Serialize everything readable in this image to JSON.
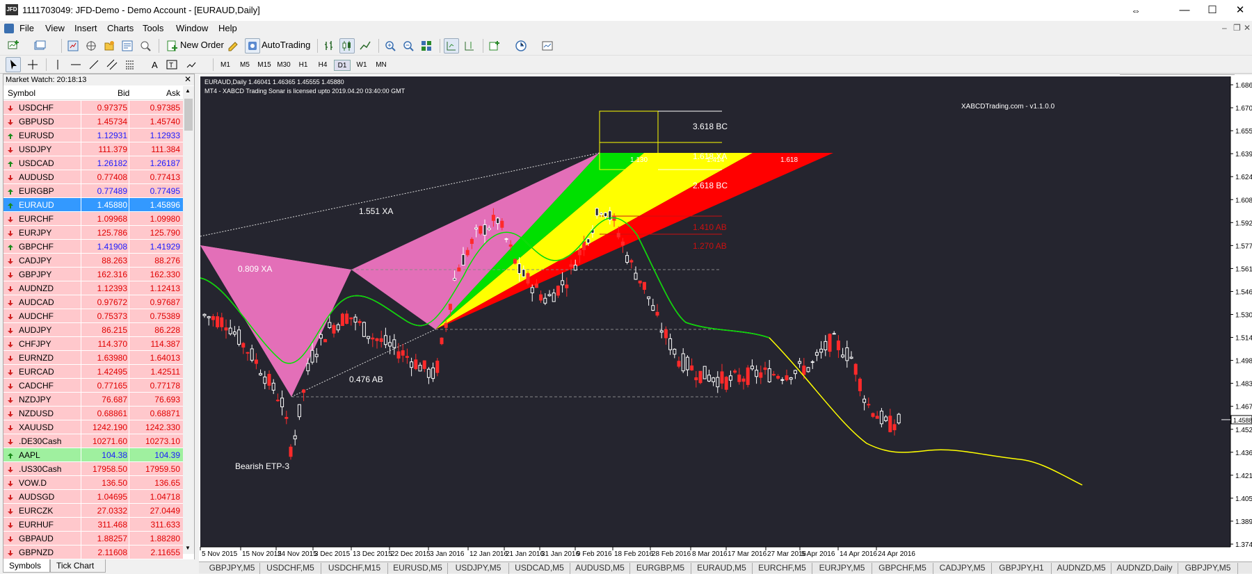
{
  "window": {
    "title": "1111703049: JFD-Demo - Demo Account - [EURAUD,Daily]",
    "app_icon_label": "JFD"
  },
  "menu": [
    "File",
    "View",
    "Insert",
    "Charts",
    "Tools",
    "Window",
    "Help"
  ],
  "toolbar": {
    "new_order": "New Order",
    "autotrading": "AutoTrading",
    "timeframes": [
      "M1",
      "M5",
      "M15",
      "M30",
      "H1",
      "H4",
      "D1",
      "W1",
      "MN"
    ],
    "selected_timeframe": "D1"
  },
  "market_watch": {
    "title": "Market Watch: 20:18:13",
    "columns": {
      "symbol": "Symbol",
      "bid": "Bid",
      "ask": "Ask"
    },
    "rows": [
      {
        "symbol": "USDCHF",
        "bid": "0.97375",
        "ask": "0.97385",
        "dir": "down"
      },
      {
        "symbol": "GBPUSD",
        "bid": "1.45734",
        "ask": "1.45740",
        "dir": "down"
      },
      {
        "symbol": "EURUSD",
        "bid": "1.12931",
        "ask": "1.12933",
        "dir": "up"
      },
      {
        "symbol": "USDJPY",
        "bid": "111.379",
        "ask": "111.384",
        "dir": "down"
      },
      {
        "symbol": "USDCAD",
        "bid": "1.26182",
        "ask": "1.26187",
        "dir": "up"
      },
      {
        "symbol": "AUDUSD",
        "bid": "0.77408",
        "ask": "0.77413",
        "dir": "down"
      },
      {
        "symbol": "EURGBP",
        "bid": "0.77489",
        "ask": "0.77495",
        "dir": "up"
      },
      {
        "symbol": "EURAUD",
        "bid": "1.45880",
        "ask": "1.45896",
        "dir": "up",
        "selected": true
      },
      {
        "symbol": "EURCHF",
        "bid": "1.09968",
        "ask": "1.09980",
        "dir": "down"
      },
      {
        "symbol": "EURJPY",
        "bid": "125.786",
        "ask": "125.790",
        "dir": "down"
      },
      {
        "symbol": "GBPCHF",
        "bid": "1.41908",
        "ask": "1.41929",
        "dir": "up"
      },
      {
        "symbol": "CADJPY",
        "bid": "88.263",
        "ask": "88.276",
        "dir": "down"
      },
      {
        "symbol": "GBPJPY",
        "bid": "162.316",
        "ask": "162.330",
        "dir": "down"
      },
      {
        "symbol": "AUDNZD",
        "bid": "1.12393",
        "ask": "1.12413",
        "dir": "down"
      },
      {
        "symbol": "AUDCAD",
        "bid": "0.97672",
        "ask": "0.97687",
        "dir": "down"
      },
      {
        "symbol": "AUDCHF",
        "bid": "0.75373",
        "ask": "0.75389",
        "dir": "down"
      },
      {
        "symbol": "AUDJPY",
        "bid": "86.215",
        "ask": "86.228",
        "dir": "down"
      },
      {
        "symbol": "CHFJPY",
        "bid": "114.370",
        "ask": "114.387",
        "dir": "down"
      },
      {
        "symbol": "EURNZD",
        "bid": "1.63980",
        "ask": "1.64013",
        "dir": "down"
      },
      {
        "symbol": "EURCAD",
        "bid": "1.42495",
        "ask": "1.42511",
        "dir": "down"
      },
      {
        "symbol": "CADCHF",
        "bid": "0.77165",
        "ask": "0.77178",
        "dir": "down"
      },
      {
        "symbol": "NZDJPY",
        "bid": "76.687",
        "ask": "76.693",
        "dir": "down"
      },
      {
        "symbol": "NZDUSD",
        "bid": "0.68861",
        "ask": "0.68871",
        "dir": "down"
      },
      {
        "symbol": "XAUUSD",
        "bid": "1242.190",
        "ask": "1242.330",
        "dir": "down"
      },
      {
        "symbol": ".DE30Cash",
        "bid": "10271.60",
        "ask": "10273.10",
        "dir": "down"
      },
      {
        "symbol": "AAPL",
        "bid": "104.38",
        "ask": "104.39",
        "dir": "up",
        "green": true
      },
      {
        "symbol": ".US30Cash",
        "bid": "17958.50",
        "ask": "17959.50",
        "dir": "down"
      },
      {
        "symbol": "VOW.D",
        "bid": "136.50",
        "ask": "136.65",
        "dir": "down"
      },
      {
        "symbol": "AUDSGD",
        "bid": "1.04695",
        "ask": "1.04718",
        "dir": "down"
      },
      {
        "symbol": "EURCZK",
        "bid": "27.0332",
        "ask": "27.0449",
        "dir": "down"
      },
      {
        "symbol": "EURHUF",
        "bid": "311.468",
        "ask": "311.633",
        "dir": "down"
      },
      {
        "symbol": "GBPAUD",
        "bid": "1.88257",
        "ask": "1.88280",
        "dir": "down"
      },
      {
        "symbol": "GBPNZD",
        "bid": "2.11608",
        "ask": "2.11655",
        "dir": "down"
      }
    ],
    "tabs": [
      "Symbols",
      "Tick Chart"
    ],
    "active_tab": "Symbols"
  },
  "chart": {
    "header": "EURAUD,Daily  1.46041 1.46365 1.45555 1.45880",
    "license": "MT4 - XABCD Trading Sonar is licensed upto 2019.04.20 03:40:00 GMT",
    "brand": "XABCDTrading.com - v1.1.0.0",
    "pattern_name": "Bearish ETP-3",
    "current_price": "1.45880",
    "annotations": {
      "xa_1551": "1.551 XA",
      "xa_0809": "0.809 XA",
      "ab_0476": "0.476 AB",
      "bc_3618": "3.618 BC",
      "xa_1618": "1.618 XA",
      "bc_2618": "2.618 BC",
      "ab_1410": "1.410 AB",
      "ab_1270": "1.270 AB",
      "fan_1130": "1.130",
      "fan_1414": "1.414",
      "fan_1618": "1.618"
    },
    "price_axis": [
      "1.6865",
      "1.6708",
      "1.6555",
      "1.6398",
      "1.6240",
      "1.6087",
      "1.5929",
      "1.5772",
      "1.5614",
      "1.5461",
      "1.5304",
      "1.5146",
      "1.4989",
      "1.4836",
      "1.4678",
      "1.4521",
      "1.4368",
      "1.4210",
      "1.4053",
      "1.3895",
      "1.3742"
    ],
    "time_axis": [
      "5 Nov 2015",
      "15 Nov 2015",
      "24 Nov 2015",
      "3 Dec 2015",
      "13 Dec 2015",
      "22 Dec 2015",
      "3 Jan 2016",
      "12 Jan 2016",
      "21 Jan 2016",
      "31 Jan 2016",
      "9 Feb 2016",
      "18 Feb 2016",
      "28 Feb 2016",
      "8 Mar 2016",
      "17 Mar 2016",
      "27 Mar 2016",
      "5 Apr 2016",
      "14 Apr 2016",
      "24 Apr 2016"
    ],
    "colors": {
      "bg": "#25252f",
      "up": "#ffffff",
      "down": "#ff2a2a",
      "pattern": "#e36fb8",
      "green": "#00e000",
      "yellow": "#ffff00",
      "red": "#ff0000"
    }
  },
  "bottom_tabs": [
    "GBPJPY,M5",
    "USDCHF,M5",
    "USDCHF,M15",
    "EURUSD,M5",
    "USDJPY,M5",
    "USDCAD,M5",
    "AUDUSD,M5",
    "EURGBP,M5",
    "EURAUD,M5",
    "EURCHF,M5",
    "EURJPY,M5",
    "GBPCHF,M5",
    "CADJPY,M5",
    "GBPJPY,H1",
    "AUDNZD,M5",
    "AUDNZD,Daily",
    "GBPJPY,M5"
  ]
}
